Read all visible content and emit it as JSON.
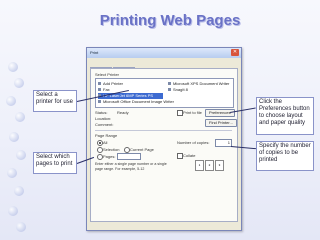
{
  "slide": {
    "title": "Printing Web Pages",
    "accent_color": "#6a72c6"
  },
  "callouts": {
    "select_printer": "Select a printer for use",
    "preferences": "Click the Preferences button to choose layout and paper quality",
    "select_pages": "Select which pages to print",
    "copies": "Specify the number of copies to be printed"
  },
  "dialog": {
    "title": "Print",
    "tabs": [
      "General",
      "Options"
    ],
    "select_printer_label": "Select Printer",
    "printers": [
      "Add Printer",
      "Fax",
      "HP LaserJet 6MP Series PS",
      "Microsoft Office Document Image Writer",
      "Microsoft XPS Document Writer",
      "SnagIt 8"
    ],
    "status_label": "Status:",
    "status_value": "Ready",
    "location_label": "Location:",
    "comment_label": "Comment:",
    "print_to_file_label": "Print to file",
    "preferences_button": "Preferences",
    "find_printer_button": "Find Printer...",
    "page_range_label": "Page Range",
    "range_all": "All",
    "range_selection": "Selection",
    "range_current": "Current Page",
    "range_pages": "Pages:",
    "page_hint_line1": "Enter either a single page number or a single",
    "page_hint_line2": "page range. For example, 5-12",
    "copies_label": "Number of copies:",
    "copies_value": "1",
    "collate_label": "Collate"
  }
}
